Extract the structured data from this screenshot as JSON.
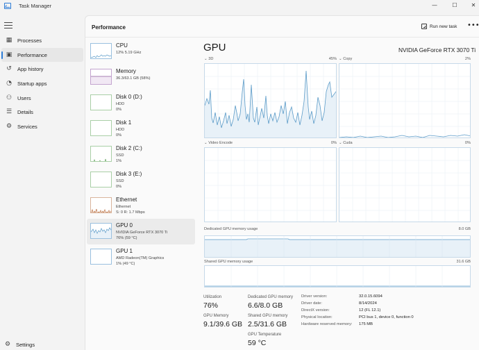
{
  "app": {
    "title": "Task Manager"
  },
  "window_controls": {
    "minimize": "—",
    "maximize": "☐",
    "close": "✕"
  },
  "nav": {
    "items": [
      {
        "label": "Processes",
        "icon": "grid-icon"
      },
      {
        "label": "Performance",
        "icon": "chart-icon",
        "active": true
      },
      {
        "label": "App history",
        "icon": "history-icon"
      },
      {
        "label": "Startup apps",
        "icon": "speedometer-icon"
      },
      {
        "label": "Users",
        "icon": "users-icon"
      },
      {
        "label": "Details",
        "icon": "list-icon"
      },
      {
        "label": "Services",
        "icon": "puzzle-icon"
      }
    ],
    "settings": "Settings"
  },
  "header": {
    "title": "Performance",
    "run_task": "Run new task",
    "more": "•••"
  },
  "devices": [
    {
      "name": "CPU",
      "sub1": "12% 5.19 GHz",
      "sub2": "",
      "sub3": ""
    },
    {
      "name": "Memory",
      "sub1": "36.3/63.1 GB (58%)",
      "sub2": "",
      "sub3": ""
    },
    {
      "name": "Disk 0 (D:)",
      "sub1": "HDD",
      "sub2": "0%",
      "sub3": ""
    },
    {
      "name": "Disk 1",
      "sub1": "HDD",
      "sub2": "0%",
      "sub3": ""
    },
    {
      "name": "Disk 2 (C:)",
      "sub1": "SSD",
      "sub2": "1%",
      "sub3": ""
    },
    {
      "name": "Disk 3 (E:)",
      "sub1": "SSD",
      "sub2": "0%",
      "sub3": ""
    },
    {
      "name": "Ethernet",
      "sub1": "Ethernet",
      "sub2": "S: 0 R: 1.7 Mbps",
      "sub3": ""
    },
    {
      "name": "GPU 0",
      "sub1": "NVIDIA GeForce RTX 3070 Ti",
      "sub2": "76% (59 °C)",
      "sub3": "",
      "active": true
    },
    {
      "name": "GPU 1",
      "sub1": "AMD Radeon(TM) Graphics",
      "sub2": "1% (49 °C)",
      "sub3": ""
    }
  ],
  "gpu": {
    "title": "GPU",
    "model": "NVIDIA GeForce RTX 3070 Ti",
    "engines": [
      {
        "label": "3D",
        "pct": "45%",
        "level": 0.45
      },
      {
        "label": "Copy",
        "pct": "2%",
        "level": 0.02
      },
      {
        "label": "Video Encode",
        "pct": "0%",
        "level": 0
      },
      {
        "label": "Cuda",
        "pct": "0%",
        "level": 0
      }
    ],
    "dedicated_label": "Dedicated GPU memory usage",
    "dedicated_max": "8.0 GB",
    "shared_label": "Shared GPU memory usage",
    "shared_max": "31.6 GB",
    "stats": {
      "utilization_label": "Utilization",
      "utilization": "76%",
      "dedicated_label": "Dedicated GPU memory",
      "dedicated": "6.6/8.0 GB",
      "gpu_memory_label": "GPU Memory",
      "gpu_memory": "9.1/39.6 GB",
      "shared_label": "Shared GPU memory",
      "shared": "2.5/31.6 GB",
      "temp_label": "GPU Temperature",
      "temp": "59 °C"
    },
    "details": [
      {
        "k": "Driver version:",
        "v": "32.0.15.6094"
      },
      {
        "k": "Driver date:",
        "v": "8/14/2024"
      },
      {
        "k": "DirectX version:",
        "v": "12 (FL 12.1)"
      },
      {
        "k": "Physical location:",
        "v": "PCI bus 1, device 0, function 0"
      },
      {
        "k": "Hardware reserved memory:",
        "v": "175 MB"
      }
    ]
  },
  "colors": {
    "accent": "#2b7bd6",
    "gpu_line": "#5b9bc8",
    "gpu_fill": "#e8f1f8",
    "memory": "#8b5a9c",
    "disk": "#5fa05a",
    "ethernet": "#b86a3a"
  }
}
